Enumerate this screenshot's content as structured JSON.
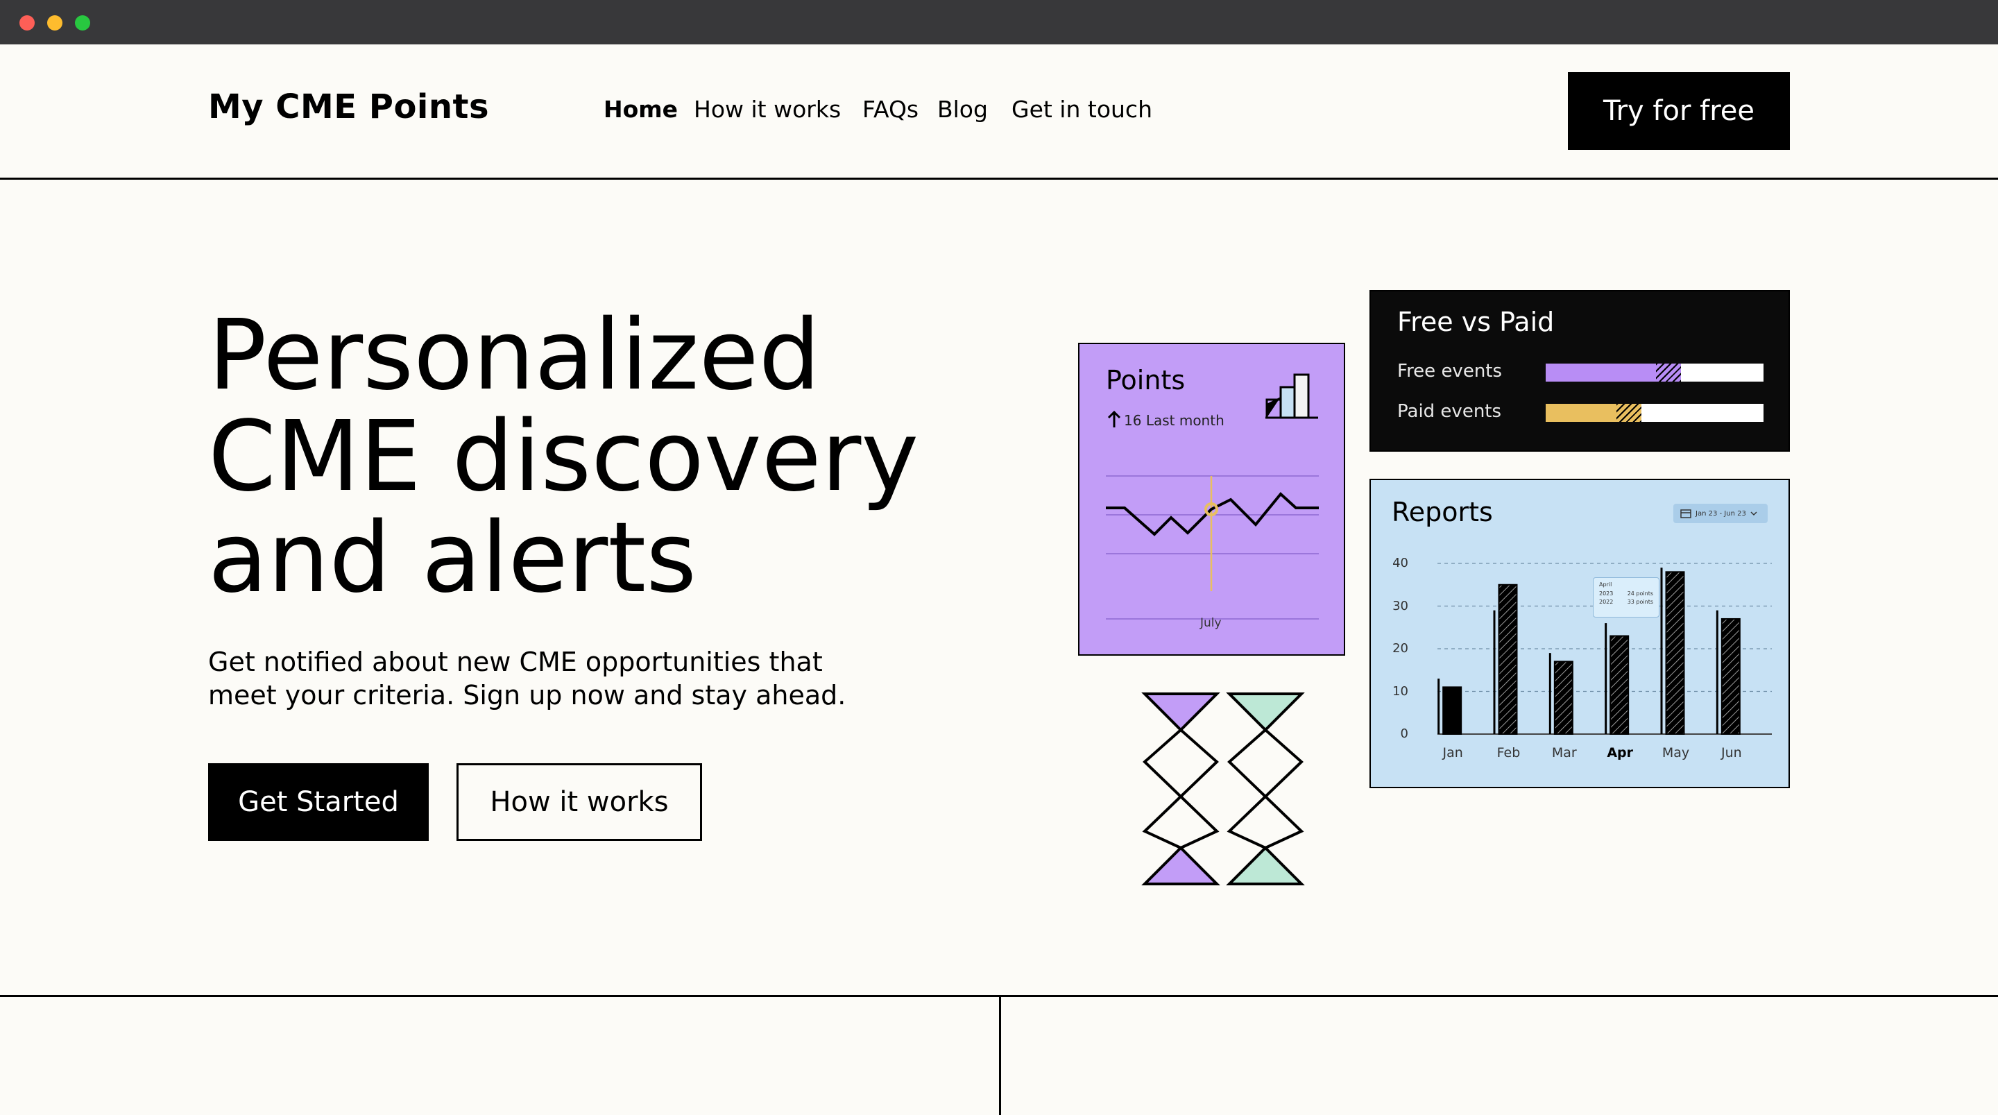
{
  "window": {
    "controls": [
      "close",
      "minimize",
      "maximize"
    ]
  },
  "header": {
    "logo": "My CME Points",
    "nav": [
      "Home",
      "How it works",
      "FAQs",
      "Blog",
      "Get in touch"
    ],
    "active_nav": "Home",
    "cta": "Try for free"
  },
  "hero": {
    "headline": [
      "Personalized",
      "CME discovery",
      "and alerts"
    ],
    "subtext": [
      "Get notified about new CME opportunities that",
      "meet your criteria. Sign up now and stay ahead."
    ],
    "primary_button": "Get Started",
    "secondary_button": "How it works"
  },
  "points_card": {
    "title": "Points",
    "change_value": "16",
    "change_label": "Last month",
    "x_label": "July"
  },
  "free_vs_paid_card": {
    "title": "Free vs Paid",
    "rows": [
      {
        "label": "Free events",
        "fill_fraction": 0.62,
        "color": "#b88df5"
      },
      {
        "label": "Paid events",
        "fill_fraction": 0.44,
        "color": "#e9bf5f"
      }
    ]
  },
  "reports_card": {
    "title": "Reports",
    "date_range": "Jan 23 - Jun 23",
    "tooltip": {
      "title": "April",
      "rows": [
        {
          "year": "2023",
          "value": "24 points"
        },
        {
          "year": "2022",
          "value": "33 points"
        }
      ]
    }
  },
  "colors": {
    "page_bg": "#fcfbf7",
    "points_bg": "#c29df7",
    "reports_bg": "#c7e1f4",
    "accent_yellow": "#e9bf5f",
    "accent_mint": "#bde8d6"
  },
  "chart_data": {
    "type": "bar",
    "title": "Reports",
    "categories": [
      "Jan",
      "Feb",
      "Mar",
      "Apr",
      "May",
      "Jun"
    ],
    "highlighted_category": "Apr",
    "series": [
      {
        "name": "2023",
        "values": [
          11,
          35,
          17,
          23,
          38,
          27
        ]
      },
      {
        "name": "2022",
        "values": [
          13,
          29,
          19,
          26,
          39,
          29
        ]
      }
    ],
    "ylim": [
      0,
      40
    ],
    "yticks": [
      "0",
      "10",
      "20",
      "30",
      "40"
    ],
    "grid": true,
    "gridlines": "dashed"
  }
}
